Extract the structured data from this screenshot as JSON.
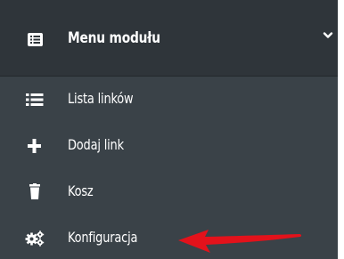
{
  "menu": {
    "header": {
      "title": "Menu modułu",
      "icon": "list-alt-icon",
      "toggle_icon": "chevron-down-icon"
    },
    "items": [
      {
        "label": "Lista linków",
        "icon": "list-icon"
      },
      {
        "label": "Dodaj link",
        "icon": "plus-icon"
      },
      {
        "label": "Kosz",
        "icon": "trash-icon"
      },
      {
        "label": "Konfiguracja",
        "icon": "cogs-icon"
      }
    ]
  },
  "annotation": {
    "arrow_color": "#e3121b",
    "points_to": "Konfiguracja"
  },
  "colors": {
    "header_bg": "#2f353a",
    "menu_bg": "#3a4248",
    "text": "#ffffff"
  }
}
